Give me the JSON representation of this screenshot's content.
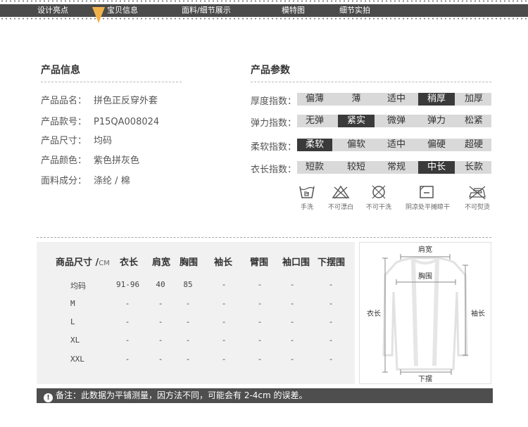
{
  "nav": {
    "items": [
      "设计亮点",
      "宝贝信息",
      "面料/细节展示",
      "模特图",
      "细节实拍"
    ]
  },
  "product_info": {
    "heading": "产品信息",
    "rows": [
      {
        "label": "产品品名：",
        "value": "拼色正反穿外套"
      },
      {
        "label": "产品款号：",
        "value": "P15QA008024"
      },
      {
        "label": "产品尺寸：",
        "value": "均码"
      },
      {
        "label": "产品颜色：",
        "value": "紫色拼灰色"
      },
      {
        "label": "面料成分：",
        "value": "涤纶 / 棉"
      }
    ]
  },
  "product_params": {
    "heading": "产品参数",
    "rows": [
      {
        "label": "厚度指数：",
        "options": [
          "偏薄",
          "薄",
          "适中",
          "稍厚",
          "加厚"
        ],
        "selected": 3
      },
      {
        "label": "弹力指数：",
        "options": [
          "无弹",
          "紧实",
          "微弹",
          "弹力",
          "松紧"
        ],
        "selected": 1
      },
      {
        "label": "柔软指数：",
        "options": [
          "柔软",
          "偏软",
          "适中",
          "偏硬",
          "超硬"
        ],
        "selected": 0
      },
      {
        "label": "衣长指数：",
        "options": [
          "短款",
          "较短",
          "常规",
          "中长",
          "长款"
        ],
        "selected": 3
      }
    ]
  },
  "care": {
    "items": [
      {
        "icon": "hand-wash-icon",
        "label": "手洗"
      },
      {
        "icon": "no-bleach-icon",
        "label": "不可漂白"
      },
      {
        "icon": "no-dry-clean-icon",
        "label": "不可干洗"
      },
      {
        "icon": "dry-flat-shade-icon",
        "label": "阴凉处平摊晾干"
      },
      {
        "icon": "no-iron-icon",
        "label": "不可熨烫"
      }
    ]
  },
  "size_table": {
    "header_main": "商品尺寸 /",
    "header_unit": "CM",
    "columns": [
      "衣长",
      "肩宽",
      "胸围",
      "袖长",
      "臂围",
      "袖口围",
      "下摆围"
    ],
    "rows": [
      {
        "size": "均码",
        "values": [
          "91-96",
          "40",
          "85",
          "-",
          "-",
          "-",
          "-"
        ]
      },
      {
        "size": "M",
        "values": [
          "-",
          "-",
          "-",
          "-",
          "-",
          "-",
          "-"
        ]
      },
      {
        "size": "L",
        "values": [
          "-",
          "-",
          "-",
          "-",
          "-",
          "-",
          "-"
        ]
      },
      {
        "size": "XL",
        "values": [
          "-",
          "-",
          "-",
          "-",
          "-",
          "-",
          "-"
        ]
      },
      {
        "size": "XXL",
        "values": [
          "-",
          "-",
          "-",
          "-",
          "-",
          "-",
          "-"
        ]
      }
    ]
  },
  "diagram": {
    "shoulder": "肩宽",
    "chest": "胸围",
    "length": "衣长",
    "sleeve": "袖长",
    "hem": "下摆"
  },
  "note": {
    "text": "备注：此数据为平铺测量，因方法不同，可能会有 2-4cm 的误差。"
  }
}
